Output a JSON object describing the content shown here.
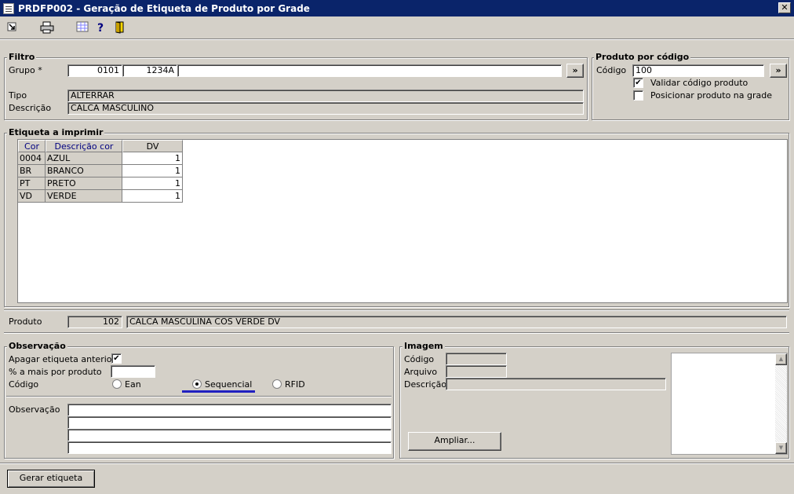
{
  "window": {
    "title": "PRDFP002 - Geração de Etiqueta de Produto por Grade",
    "close": "✕"
  },
  "toolbar": {
    "items": [
      "exit-icon",
      "print-icon",
      "grid-icon",
      "help-icon",
      "door-icon"
    ]
  },
  "filtro": {
    "legend": "Filtro",
    "grupo_label": "Grupo *",
    "grupo_code": "0101",
    "grupo_sub": "1234A",
    "grupo_desc": "",
    "lookup_label": "»",
    "tipo_label": "Tipo",
    "tipo_value": "ALTERRAR",
    "descricao_label": "Descrição",
    "descricao_value": "CALCA  MASCULINO"
  },
  "produto_codigo": {
    "legend": "Produto por código",
    "codigo_label": "Código",
    "codigo_value": "100",
    "lookup_label": "»",
    "validar_label": "Validar código produto",
    "validar_checked": "✔",
    "posicionar_label": "Posicionar produto na grade",
    "posicionar_checked": ""
  },
  "etiqueta": {
    "legend": "Etiqueta a imprimir",
    "columns": [
      "Cor",
      "Descrição cor",
      "DV"
    ],
    "rows": [
      {
        "cor": "0004",
        "descricao": "AZUL",
        "dv": "1"
      },
      {
        "cor": "BR",
        "descricao": "BRANCO",
        "dv": "1"
      },
      {
        "cor": "PT",
        "descricao": "PRETO",
        "dv": "1"
      },
      {
        "cor": "VD",
        "descricao": "VERDE",
        "dv": "1"
      }
    ]
  },
  "produto": {
    "label": "Produto",
    "code": "102",
    "desc": "CALCA MASCULINA COS VERDE DV"
  },
  "observacao": {
    "legend": "Observação",
    "apagar_label": "Apagar etiqueta anterior",
    "apagar_checked": "✔",
    "pct_label": "% a mais por produto",
    "pct_value": "",
    "codigo_label": "Código",
    "options": [
      "Ean",
      "Sequencial",
      "RFID"
    ],
    "selected": "Sequencial",
    "obs_label": "Observação",
    "obs_lines": [
      "",
      "",
      "",
      ""
    ]
  },
  "imagem": {
    "legend": "Imagem",
    "codigo_label": "Código",
    "arquivo_label": "Arquivo",
    "descricao_label": "Descrição",
    "ampliar_label": "Ampliar...",
    "scroll_up": "▲",
    "scroll_down": "▼"
  },
  "footer": {
    "gerar_label": "Gerar etiqueta"
  }
}
